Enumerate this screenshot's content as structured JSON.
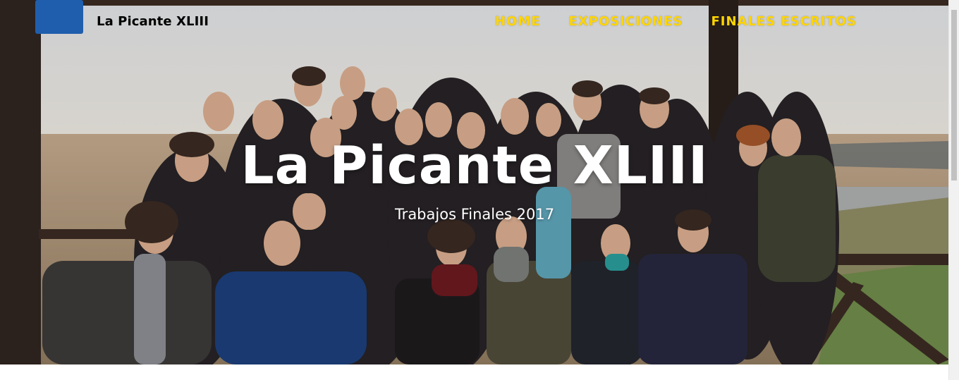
{
  "navbar": {
    "brand": "La Picante XLIII",
    "links": [
      {
        "label": "HOME"
      },
      {
        "label": "EXPOSICIONES"
      },
      {
        "label": "FINALES ESCRITOS"
      }
    ],
    "link_color": "#ffd500"
  },
  "hero": {
    "title": "La Picante XLIII",
    "subtitle": "Trabajos Finales 2017",
    "background_image": "group-photo"
  }
}
